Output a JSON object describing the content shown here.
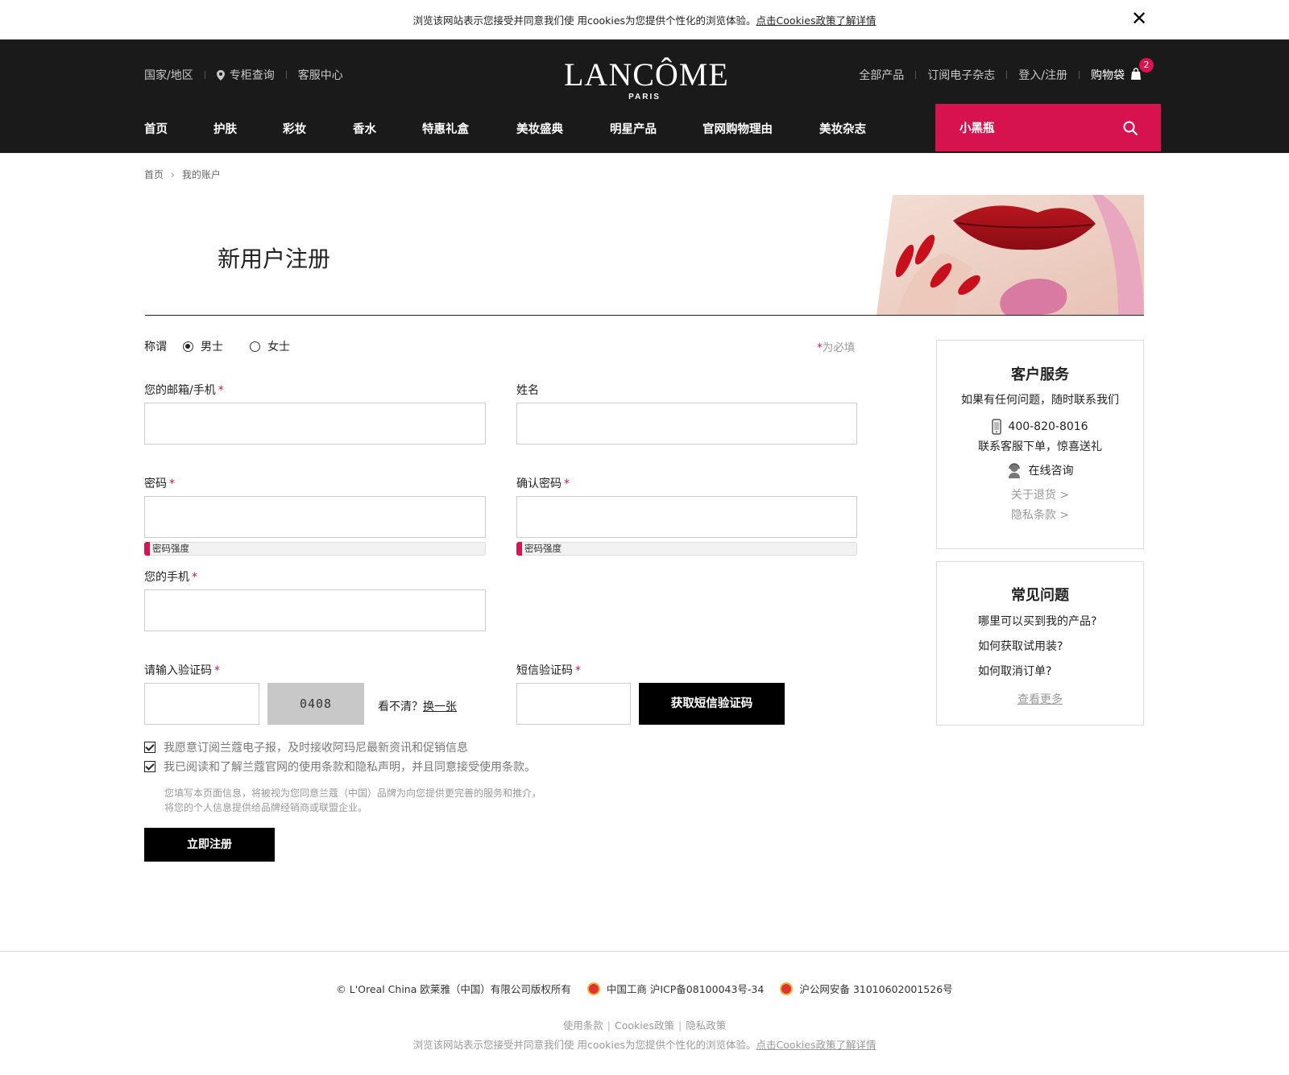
{
  "cookie_bar": {
    "text": "浏览该网站表示您接受并同意我们使 用cookies为您提供个性化的浏览体验。",
    "link": "点击Cookies政策了解详情",
    "close": "✕"
  },
  "header": {
    "util_left": [
      "国家/地区",
      "专柜查询",
      "客服中心"
    ],
    "logo": {
      "main": "LANCÔME",
      "sub": "PARIS"
    },
    "util_right": [
      "全部产品",
      "订阅电子杂志",
      "登入/注册"
    ],
    "cart": {
      "label": "购物袋",
      "count": "2"
    },
    "nav": [
      "首页",
      "护肤",
      "彩妆",
      "香水",
      "特惠礼盒",
      "美妆盛典",
      "明星产品",
      "官网购物理由",
      "美妆杂志"
    ],
    "search_value": "小黑瓶",
    "accent": "#d7134f"
  },
  "breadcrumb": [
    "首页",
    "我的账户"
  ],
  "page_title": "新用户注册",
  "form": {
    "salutation_label": "称谓",
    "salutation_options": [
      "男士",
      "女士"
    ],
    "salutation_selected": "男士",
    "required_note": "为必填",
    "required_mark": "*",
    "email_label": "您的邮箱/手机",
    "name_label": "姓名",
    "password_label": "密码",
    "confirm_password_label": "确认密码",
    "strength_label": "密码强度",
    "phone_label": "您的手机",
    "captcha_label": "请输入验证码",
    "captcha_value": "0408",
    "captcha_unclear": "看不清？",
    "captcha_refresh": "换一张",
    "sms_label": "短信验证码",
    "sms_button": "获取短信验证码",
    "checkbox_newsletter": "我愿意订阅兰蔻电子报，及时接收阿玛尼最新资讯和促销信息",
    "checkbox_terms": "我已阅读和了解兰蔻官网的使用条款和隐私声明，并且同意接受使用条款。",
    "privacy_note_1": "您填写本页面信息，将被视为您同意兰蔻（中国）品牌为向您提供更完善的服务和推介，",
    "privacy_note_2": "将您的个人信息提供给品牌经销商或联盟企业。",
    "submit": "立即注册"
  },
  "customer_service": {
    "title": "客户服务",
    "subtitle": "如果有任何问题，随时联系我们",
    "phone": "400-820-8016",
    "phone_note": "联系客服下单，惊喜送礼",
    "online": "在线咨询",
    "links": [
      "关于退货 >",
      "隐私条款 >"
    ]
  },
  "faq": {
    "title": "常见问题",
    "questions": [
      "哪里可以买到我的产品?",
      "如何获取试用装?",
      "如何取消订单?"
    ],
    "more": "查看更多"
  },
  "footer": {
    "copyright": "© L'Oreal China 欧莱雅（中国）有限公司版权所有",
    "icp": "中国工商 沪ICP备08100043号-34",
    "police": "沪公网安备 31010602001526号",
    "links": [
      "使用条款",
      "Cookies政策",
      "隐私政策"
    ],
    "cookie_text": "浏览该网站表示您接受并同意我们使 用cookies为您提供个性化的浏览体验。",
    "cookie_link": "点击Cookies政策了解详情"
  }
}
